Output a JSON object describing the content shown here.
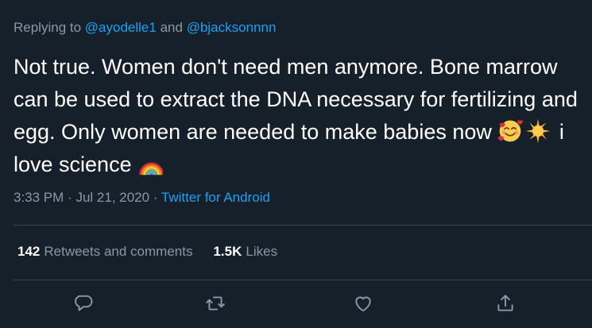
{
  "reply": {
    "prefix": "Replying to",
    "mention1": "@ayodelle1",
    "conjunction": "and",
    "mention2": "@bjacksonnnn"
  },
  "tweet": {
    "text_part1": "Not true. Women don't need men anymore. Bone marrow can be used to extract the DNA necessary for fertilizing and egg. Only women are needed to make babies now",
    "text_part2": "i love science",
    "emojis": [
      "smiling-face-with-hearts",
      "sun",
      "rainbow"
    ]
  },
  "meta": {
    "time": "3:33 PM",
    "separator1": "·",
    "date": "Jul 21, 2020",
    "separator2": "·",
    "source": "Twitter for Android"
  },
  "stats": {
    "retweets_count": "142",
    "retweets_label": "Retweets and comments",
    "likes_count": "1.5K",
    "likes_label": "Likes"
  },
  "actions": {
    "icons": [
      "reply-icon",
      "retweet-icon",
      "like-icon",
      "share-icon"
    ]
  },
  "colors": {
    "background": "#15202b",
    "text": "#ffffff",
    "muted": "#8899a6",
    "accent": "#1da1f2",
    "divider": "#38444d"
  }
}
